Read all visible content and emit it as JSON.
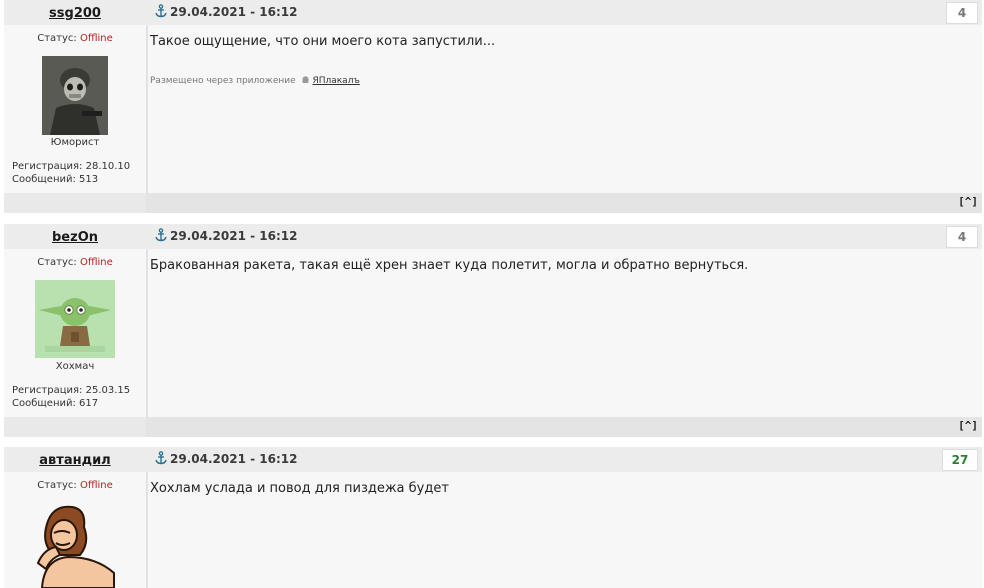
{
  "posts": [
    {
      "nick": "ssg200",
      "date": "29.04.2021 - 16:12",
      "rating": "4",
      "status_label": "Статус:",
      "status_value": "Offline",
      "user_title": "Юморист",
      "registration": "Регистрация: 28.10.10",
      "messages": "Сообщений: 513",
      "text": "Такое ощущение, что они моего кота запустили...",
      "via_label": "Размещено через приложение",
      "via_app": "ЯПлакалъ",
      "up": "[^]"
    },
    {
      "nick": "bezOn",
      "date": "29.04.2021 - 16:12",
      "rating": "4",
      "status_label": "Статус:",
      "status_value": "Offline",
      "user_title": "Хохмач",
      "registration": "Регистрация: 25.03.15",
      "messages": "Сообщений: 617",
      "text": "Бракованная ракета, такая ещё хрен знает куда полетит, могла и обратно вернуться.",
      "up": "[^]"
    },
    {
      "nick": "автандил",
      "date": "29.04.2021 - 16:12",
      "rating": "27",
      "status_label": "Статус:",
      "status_value": "Offline",
      "text": "Хохлам услада и повод для пиздежа будет"
    }
  ],
  "colors": {
    "rating_positive": "#2e7d32",
    "offline": "#b22222"
  }
}
